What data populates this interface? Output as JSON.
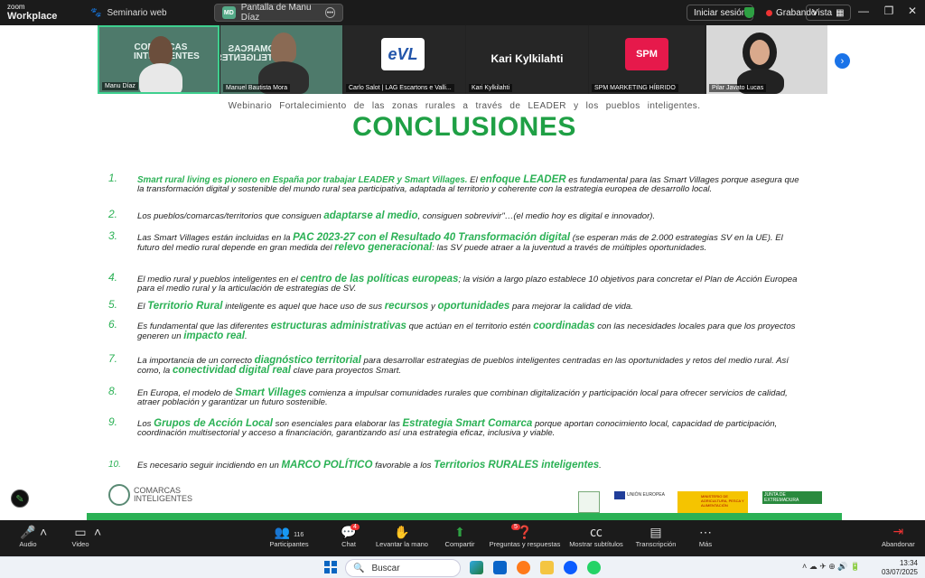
{
  "app": {
    "brand_small": "zoom",
    "brand_big": "Workplace",
    "tab1": "Seminario web",
    "tab2_badge": "MD",
    "tab2": "Pantalla de Manu Díaz",
    "login": "Iniciar sesión",
    "recording": "Grabando",
    "view": "Vista"
  },
  "participants": [
    {
      "name": "Manu Díaz",
      "logo": "COMARCAS INTELIGENTES"
    },
    {
      "name": "Manuel Bautista Mora",
      "logo": "COMARCAS INTELIGENTES"
    },
    {
      "name": "Carlo Salot | LAG Escartons e Valli...",
      "logo": "eVL"
    },
    {
      "name": "Kari Kylkilahti",
      "center_name": "Kari Kylkilahti"
    },
    {
      "name": "SPM MARKETING HÍBRIDO",
      "logo": "SPM"
    },
    {
      "name": "Pilar Javato Lucas"
    }
  ],
  "slide": {
    "subtitle": "Webinario Fortalecimiento de las zonas rurales a través de LEADER y los pueblos inteligentes.",
    "title": "CONCLUSIONES",
    "points": [
      {
        "n": "1.",
        "parts": [
          {
            "t": "Smart rural living es pionero en España por trabajar LEADER y Smart Villages.",
            "g": true,
            "s": true
          },
          {
            "t": " El "
          },
          {
            "t": "enfoque LEADER",
            "g": true
          },
          {
            "t": " es fundamental para las Smart Villages porque asegura que la transformación digital y sostenible del mundo rural sea participativa, adaptada al territorio y coherente con la estrategia europea de desarrollo local."
          }
        ]
      },
      {
        "n": "2.",
        "parts": [
          {
            "t": "Los pueblos/comarcas/territorios que consiguen "
          },
          {
            "t": "adaptarse al medio",
            "g": true
          },
          {
            "t": ", consiguen sobrevivir\"…(el medio hoy es digital e innovador)."
          }
        ]
      },
      {
        "n": "3.",
        "parts": [
          {
            "t": "Las Smart Villages están incluidas en la "
          },
          {
            "t": "PAC 2023-27 con el Resultado 40 Transformación digital",
            "g": true
          },
          {
            "t": " (se esperan más de 2.000 estrategias SV en la UE). El futuro del medio rural depende en gran medida del "
          },
          {
            "t": "relevo generacional",
            "g": true
          },
          {
            "t": ": las SV puede atraer a la juventud a través de múltiples oportunidades."
          }
        ]
      },
      {
        "n": "4.",
        "parts": [
          {
            "t": "El medio rural y pueblos inteligentes en el "
          },
          {
            "t": "centro de las políticas europeas",
            "g": true
          },
          {
            "t": "; la visión a largo plazo establece 10 objetivos para concretar el Plan de Acción Europea para el medio rural y la articulación de estrategias de SV."
          }
        ]
      },
      {
        "n": "5.",
        "parts": [
          {
            "t": "El "
          },
          {
            "t": "Territorio Rural",
            "g": true
          },
          {
            "t": " inteligente es aquel que hace uso de sus "
          },
          {
            "t": "recursos",
            "g": true
          },
          {
            "t": " y "
          },
          {
            "t": "oportunidades",
            "g": true
          },
          {
            "t": " para mejorar la calidad de vida."
          }
        ]
      },
      {
        "n": "6.",
        "parts": [
          {
            "t": "Es fundamental que las diferentes "
          },
          {
            "t": "estructuras administrativas",
            "g": true
          },
          {
            "t": " que actúan en el territorio estén "
          },
          {
            "t": "coordinadas",
            "g": true
          },
          {
            "t": " con las necesidades locales para que los proyectos generen un "
          },
          {
            "t": "impacto real",
            "g": true
          },
          {
            "t": "."
          }
        ]
      },
      {
        "n": "7.",
        "parts": [
          {
            "t": " La importancia de un correcto "
          },
          {
            "t": "diagnóstico territorial",
            "g": true
          },
          {
            "t": " para desarrollar estrategias de pueblos inteligentes centradas en las oportunidades y retos del medio rural. Así como, la "
          },
          {
            "t": "conectividad digital real",
            "g": true
          },
          {
            "t": " clave para proyectos Smart."
          }
        ]
      },
      {
        "n": "8.",
        "parts": [
          {
            "t": "En Europa, el modelo de "
          },
          {
            "t": "Smart Villages",
            "g": true
          },
          {
            "t": " comienza a impulsar comunidades rurales que combinan digitalización y participación local para ofrecer servicios de calidad, atraer población y garantizar un futuro sostenible."
          }
        ]
      },
      {
        "n": "9.",
        "parts": [
          {
            "t": " Los "
          },
          {
            "t": "Grupos de Acción Local",
            "g": true
          },
          {
            "t": " son esenciales para elaborar las "
          },
          {
            "t": "Estrategia Smart Comarca",
            "g": true
          },
          {
            "t": " porque aportan conocimiento local, capacidad de participación, coordinación multisectorial y acceso a financiación, garantizando así una estrategia eficaz, inclusiva y viable."
          }
        ]
      },
      {
        "n": "10.",
        "parts": [
          {
            "t": "Es necesario seguir incidiendo en un "
          },
          {
            "t": "MARCO POLÍTICO",
            "g": true
          },
          {
            "t": " favorable a los "
          },
          {
            "t": "Territorios RURALES inteligentes",
            "g": true
          },
          {
            "t": "."
          }
        ]
      }
    ],
    "footer": {
      "ci_logo": "COMARCAS INTELIGENTES",
      "eu": "UNIÓN EUROPEA",
      "ministry": "MINISTERIO DE AGRICULTURA, PESCA Y ALIMENTACIÓN",
      "junta": "JUNTA DE EXTREMADURA"
    }
  },
  "toolbar": {
    "audio": "Audio",
    "video": "Video",
    "participants": "Participantes",
    "participants_count": "116",
    "chat": "Chat",
    "chat_badge": "4",
    "raise": "Levantar la mano",
    "share": "Compartir",
    "qa": "Preguntas y respuestas",
    "qa_badge": "5",
    "subtitles": "Mostrar subtítulos",
    "transcription": "Transcripción",
    "more": "Más",
    "leave": "Abandonar"
  },
  "taskbar": {
    "search": "Buscar",
    "time": "13:34",
    "date": "03/07/2025"
  },
  "colors": {
    "accent_green": "#2bb155",
    "title_green": "#1fa045",
    "zoom_blue": "#1a73e8",
    "record_red": "#e33333"
  }
}
